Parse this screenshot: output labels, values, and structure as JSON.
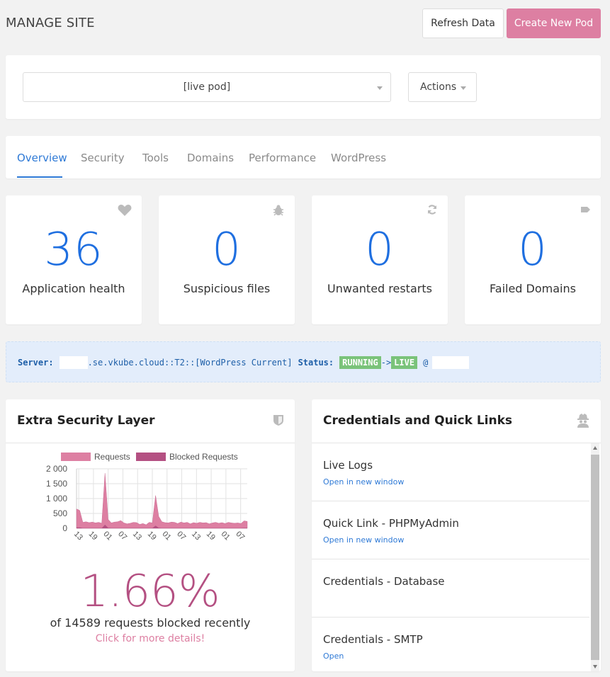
{
  "header": {
    "title": "MANAGE SITE",
    "refresh_label": "Refresh Data",
    "create_label": "Create New Pod"
  },
  "pod_selector": {
    "selected": "[live pod]",
    "actions_label": "Actions"
  },
  "tabs": [
    {
      "label": "Overview",
      "active": true
    },
    {
      "label": "Security"
    },
    {
      "label": "Tools"
    },
    {
      "label": "Domains"
    },
    {
      "label": "Performance"
    },
    {
      "label": "WordPress"
    }
  ],
  "stats": [
    {
      "value": "36",
      "label": "Application health",
      "icon": "heart-icon"
    },
    {
      "value": "0",
      "label": "Suspicious files",
      "icon": "bug-icon"
    },
    {
      "value": "0",
      "label": "Unwanted restarts",
      "icon": "refresh-icon"
    },
    {
      "value": "0",
      "label": "Failed Domains",
      "icon": "tag-icon"
    }
  ],
  "server": {
    "server_label": "Server:",
    "host_suffix": ".se.vkube.cloud::T2::[WordPress Current]",
    "status_label": "Status:",
    "status_running": "RUNNING",
    "arrow": "->",
    "status_live": "LIVE",
    "at": "@"
  },
  "security": {
    "title": "Extra Security Layer",
    "percentage": "1.66%",
    "blocked_text": "of 14589 requests blocked recently",
    "details_link": "Click for more details!"
  },
  "credentials": {
    "title": "Credentials and Quick Links",
    "items": [
      {
        "title": "Live Logs",
        "link": "Open in new window"
      },
      {
        "title": "Quick Link - PHPMyAdmin",
        "link": "Open in new window"
      },
      {
        "title": "Credentials - Database",
        "link": ""
      },
      {
        "title": "Credentials - SMTP",
        "link": "Open"
      }
    ]
  },
  "colors": {
    "accent_blue": "#1f6fe0",
    "brand_pink": "#dd7fa2",
    "blocked_pink": "#b45082",
    "status_green": "#7ac37a"
  },
  "chart_data": {
    "type": "area",
    "legend": [
      "Requests",
      "Blocked Requests"
    ],
    "legend_position": "top",
    "grid": true,
    "ylim": [
      0,
      2000
    ],
    "y_ticks": [
      "2 000",
      "1 500",
      "1 000",
      "500",
      "0"
    ],
    "x_ticks": [
      "13",
      "19",
      "01",
      "07",
      "13",
      "19",
      "01",
      "07",
      "13",
      "19",
      "01",
      "07"
    ],
    "series": [
      {
        "name": "Requests",
        "values": [
          650,
          600,
          200,
          220,
          190,
          210,
          180,
          200,
          170,
          1850,
          300,
          180,
          210,
          220,
          260,
          180,
          150,
          170,
          200,
          190,
          130,
          160,
          120,
          200,
          180,
          1100,
          400,
          220,
          190,
          180,
          210,
          200,
          160,
          210,
          180,
          200,
          150,
          190,
          170,
          200,
          180,
          190,
          150,
          180,
          200,
          170,
          190,
          160,
          200,
          180,
          170,
          180,
          160,
          250,
          230
        ]
      },
      {
        "name": "Blocked Requests",
        "values": [
          30,
          30,
          10,
          10,
          10,
          10,
          10,
          10,
          10,
          120,
          20,
          10,
          10,
          10,
          10,
          10,
          10,
          10,
          10,
          10,
          10,
          10,
          10,
          10,
          10,
          90,
          20,
          10,
          10,
          10,
          10,
          10,
          10,
          10,
          10,
          10,
          10,
          10,
          10,
          10,
          10,
          10,
          10,
          10,
          10,
          10,
          10,
          10,
          10,
          10,
          10,
          10,
          10,
          15,
          15
        ]
      }
    ]
  }
}
